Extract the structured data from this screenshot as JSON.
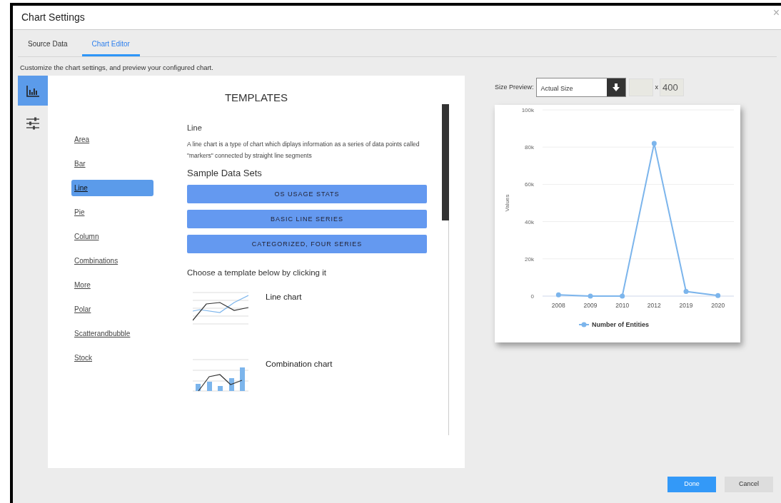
{
  "window": {
    "title": "Chart Settings",
    "close": "×"
  },
  "tabs": [
    {
      "label": "Source Data",
      "selected": false
    },
    {
      "label": "Chart Editor",
      "selected": true
    }
  ],
  "description": "Customize the chart settings, and preview your configured chart.",
  "icon_tabs": [
    {
      "kind": "chart",
      "selected": true
    },
    {
      "kind": "sliders",
      "selected": false
    }
  ],
  "templates": {
    "title": "TEMPLATES",
    "types": [
      {
        "label": "Area",
        "selected": false
      },
      {
        "label": "Bar",
        "selected": false
      },
      {
        "label": "Line",
        "selected": true
      },
      {
        "label": "Pie",
        "selected": false
      },
      {
        "label": "Column",
        "selected": false
      },
      {
        "label": "Combinations",
        "selected": false
      },
      {
        "label": "More",
        "selected": false
      },
      {
        "label": "Polar",
        "selected": false
      },
      {
        "label": "Scatterandbubble",
        "selected": false
      },
      {
        "label": "Stock",
        "selected": false
      }
    ],
    "heading": "Line",
    "text": "A line chart is a type of chart which diplays information as a series of data points called \"markers\" connected by straight line segments",
    "sample_title": "Sample Data Sets",
    "sample_buttons": [
      "OS USAGE STATS",
      "BASIC LINE SERIES",
      "CATEGORIZED, FOUR SERIES"
    ],
    "choose_text": "Choose a template below by clicking it",
    "items": [
      {
        "label": "Line chart",
        "kind": "line"
      },
      {
        "label": "Combination chart",
        "kind": "combination"
      }
    ]
  },
  "preview": {
    "size_label": "Size Preview:",
    "size_value": "Actual Size",
    "times": "x",
    "height_value": "400",
    "chart_data": {
      "type": "line",
      "ylabel": "Values",
      "categories": [
        "2008",
        "2009",
        "2010",
        "2012",
        "2019",
        "2020"
      ],
      "grid": true,
      "series": [
        {
          "name": "Number of Entities",
          "color": "#7cb5ec",
          "marker": true,
          "values": [
            700,
            0,
            0,
            82000,
            2500,
            300
          ]
        }
      ],
      "ylim": [
        0,
        100000
      ],
      "yticks": [
        {
          "value": 0,
          "label": "0"
        },
        {
          "value": 20000,
          "label": "20k"
        },
        {
          "value": 40000,
          "label": "40k"
        },
        {
          "value": 60000,
          "label": "60k"
        },
        {
          "value": 80000,
          "label": "80k"
        },
        {
          "value": 100000,
          "label": "100k"
        }
      ]
    }
  },
  "buttons": [
    {
      "label": "Done",
      "kind": "primary"
    },
    {
      "label": "Cancel",
      "kind": "secondary"
    }
  ]
}
